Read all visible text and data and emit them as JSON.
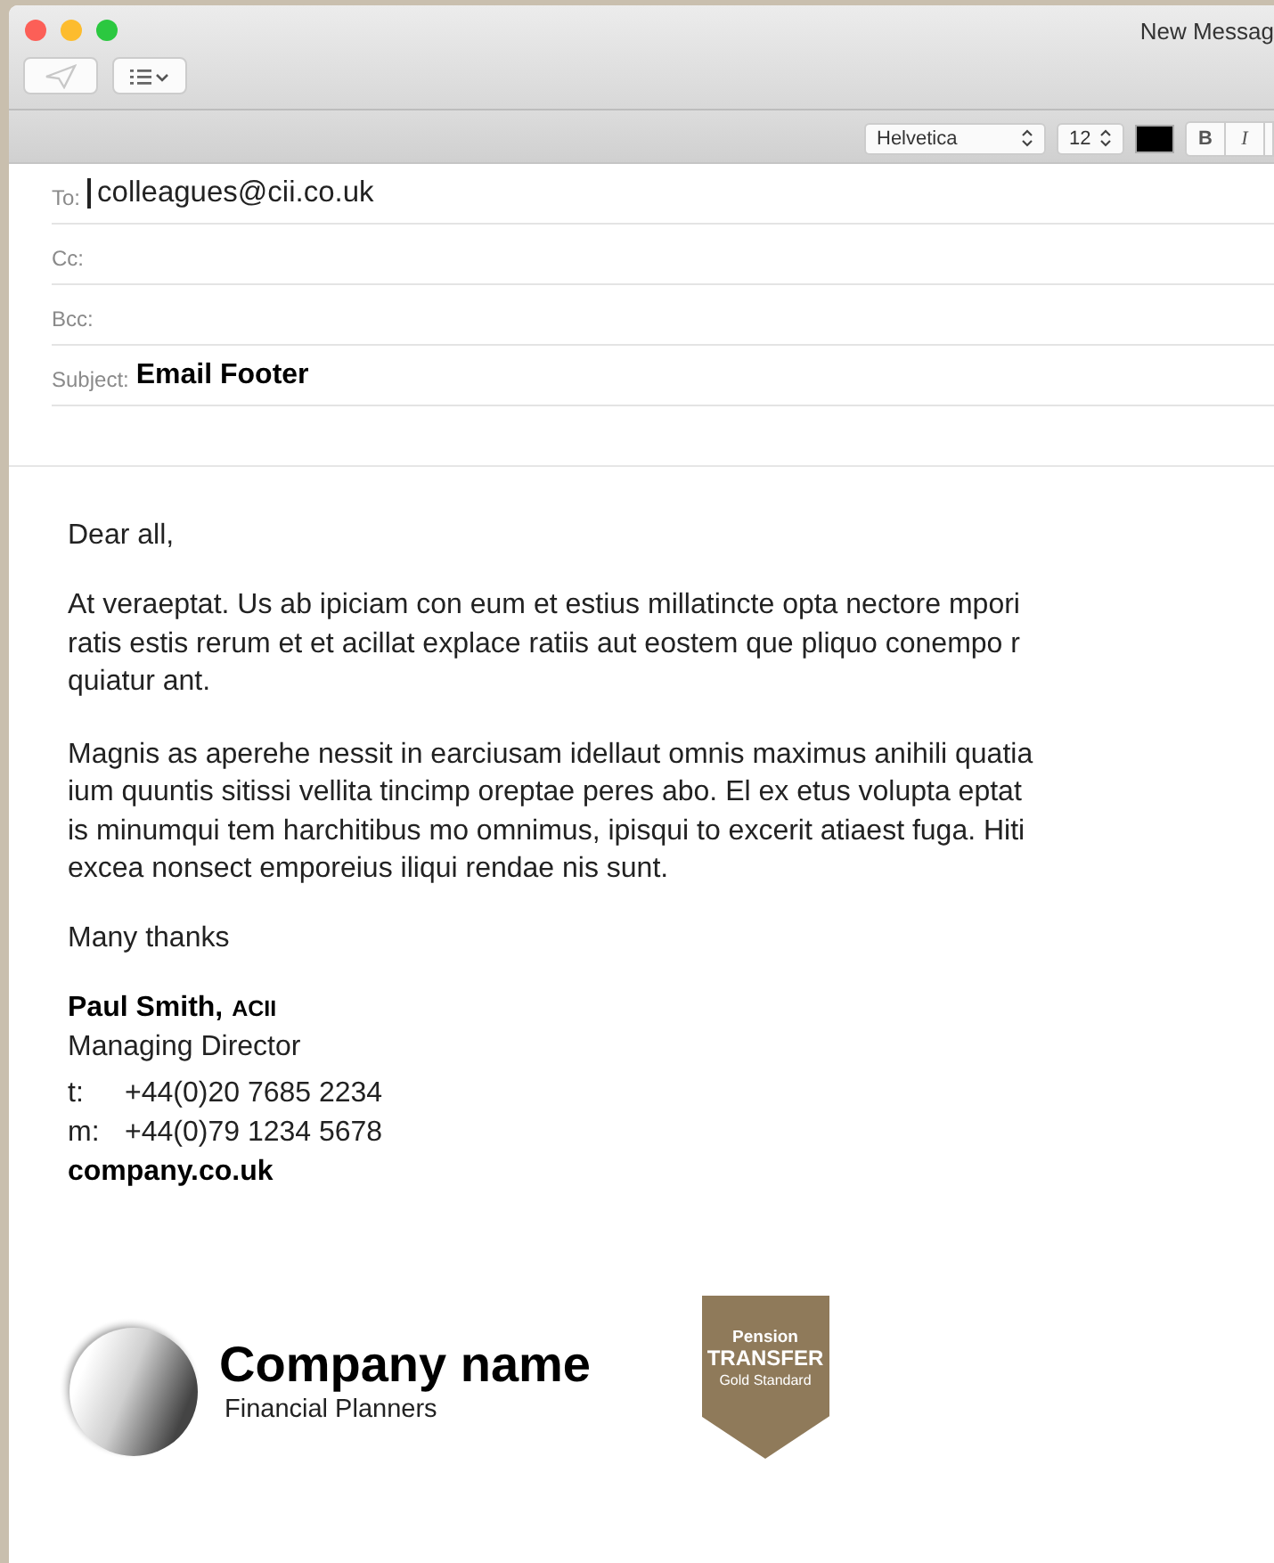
{
  "window": {
    "title": "New Messag"
  },
  "format_bar": {
    "font": "Helvetica",
    "size": "12",
    "color": "#000000",
    "styles": [
      {
        "label": "B",
        "kind": "bold"
      },
      {
        "label": "I",
        "kind": "italic"
      }
    ]
  },
  "header_fields": [
    {
      "label": "To:",
      "value": "colleagues@cii.co.uk",
      "focused": true,
      "kind": "plain"
    },
    {
      "label": "Cc:",
      "focused": false
    },
    {
      "label": "Bcc:",
      "focused": false
    },
    {
      "label": "Subject:",
      "value": "Email Footer",
      "focused": false,
      "kind": "bold"
    }
  ],
  "body": {
    "greeting": "Dear all,",
    "paragraphs": [
      [
        "At veraeptat. Us ab ipiciam con eum et estius millatincte opta nectore mpori",
        "ratis estis rerum et et acillat explace ratiis aut eostem que pliquo conempo r",
        "quiatur ant."
      ],
      [
        "Magnis as aperehe nessit in earciusam idellaut omnis maximus anihili quatia",
        "ium quuntis sitissi vellita tincimp oreptae peres abo. El ex etus volupta eptat",
        "is minumqui tem harchitibus mo omnimus, ipisqui to excerit atiaest fuga. Hiti",
        "excea nonsect emporeius iliqui rendae nis sunt."
      ]
    ],
    "signoff": "Many thanks"
  },
  "signature": {
    "name": "Paul Smith,",
    "credential": "ACII",
    "role": "Managing Director",
    "phones": [
      {
        "label": "t:",
        "number": "+44(0)20 7685 2234"
      },
      {
        "label": "m:",
        "number": "+44(0)79 1234 5678"
      }
    ],
    "website": "company.co.uk"
  },
  "logo": {
    "company": "Company name",
    "tagline": "Financial Planners"
  },
  "badge": {
    "lines": [
      "Pension",
      "TRANSFER",
      "Gold Standard"
    ],
    "color": "#8f7a5a"
  }
}
